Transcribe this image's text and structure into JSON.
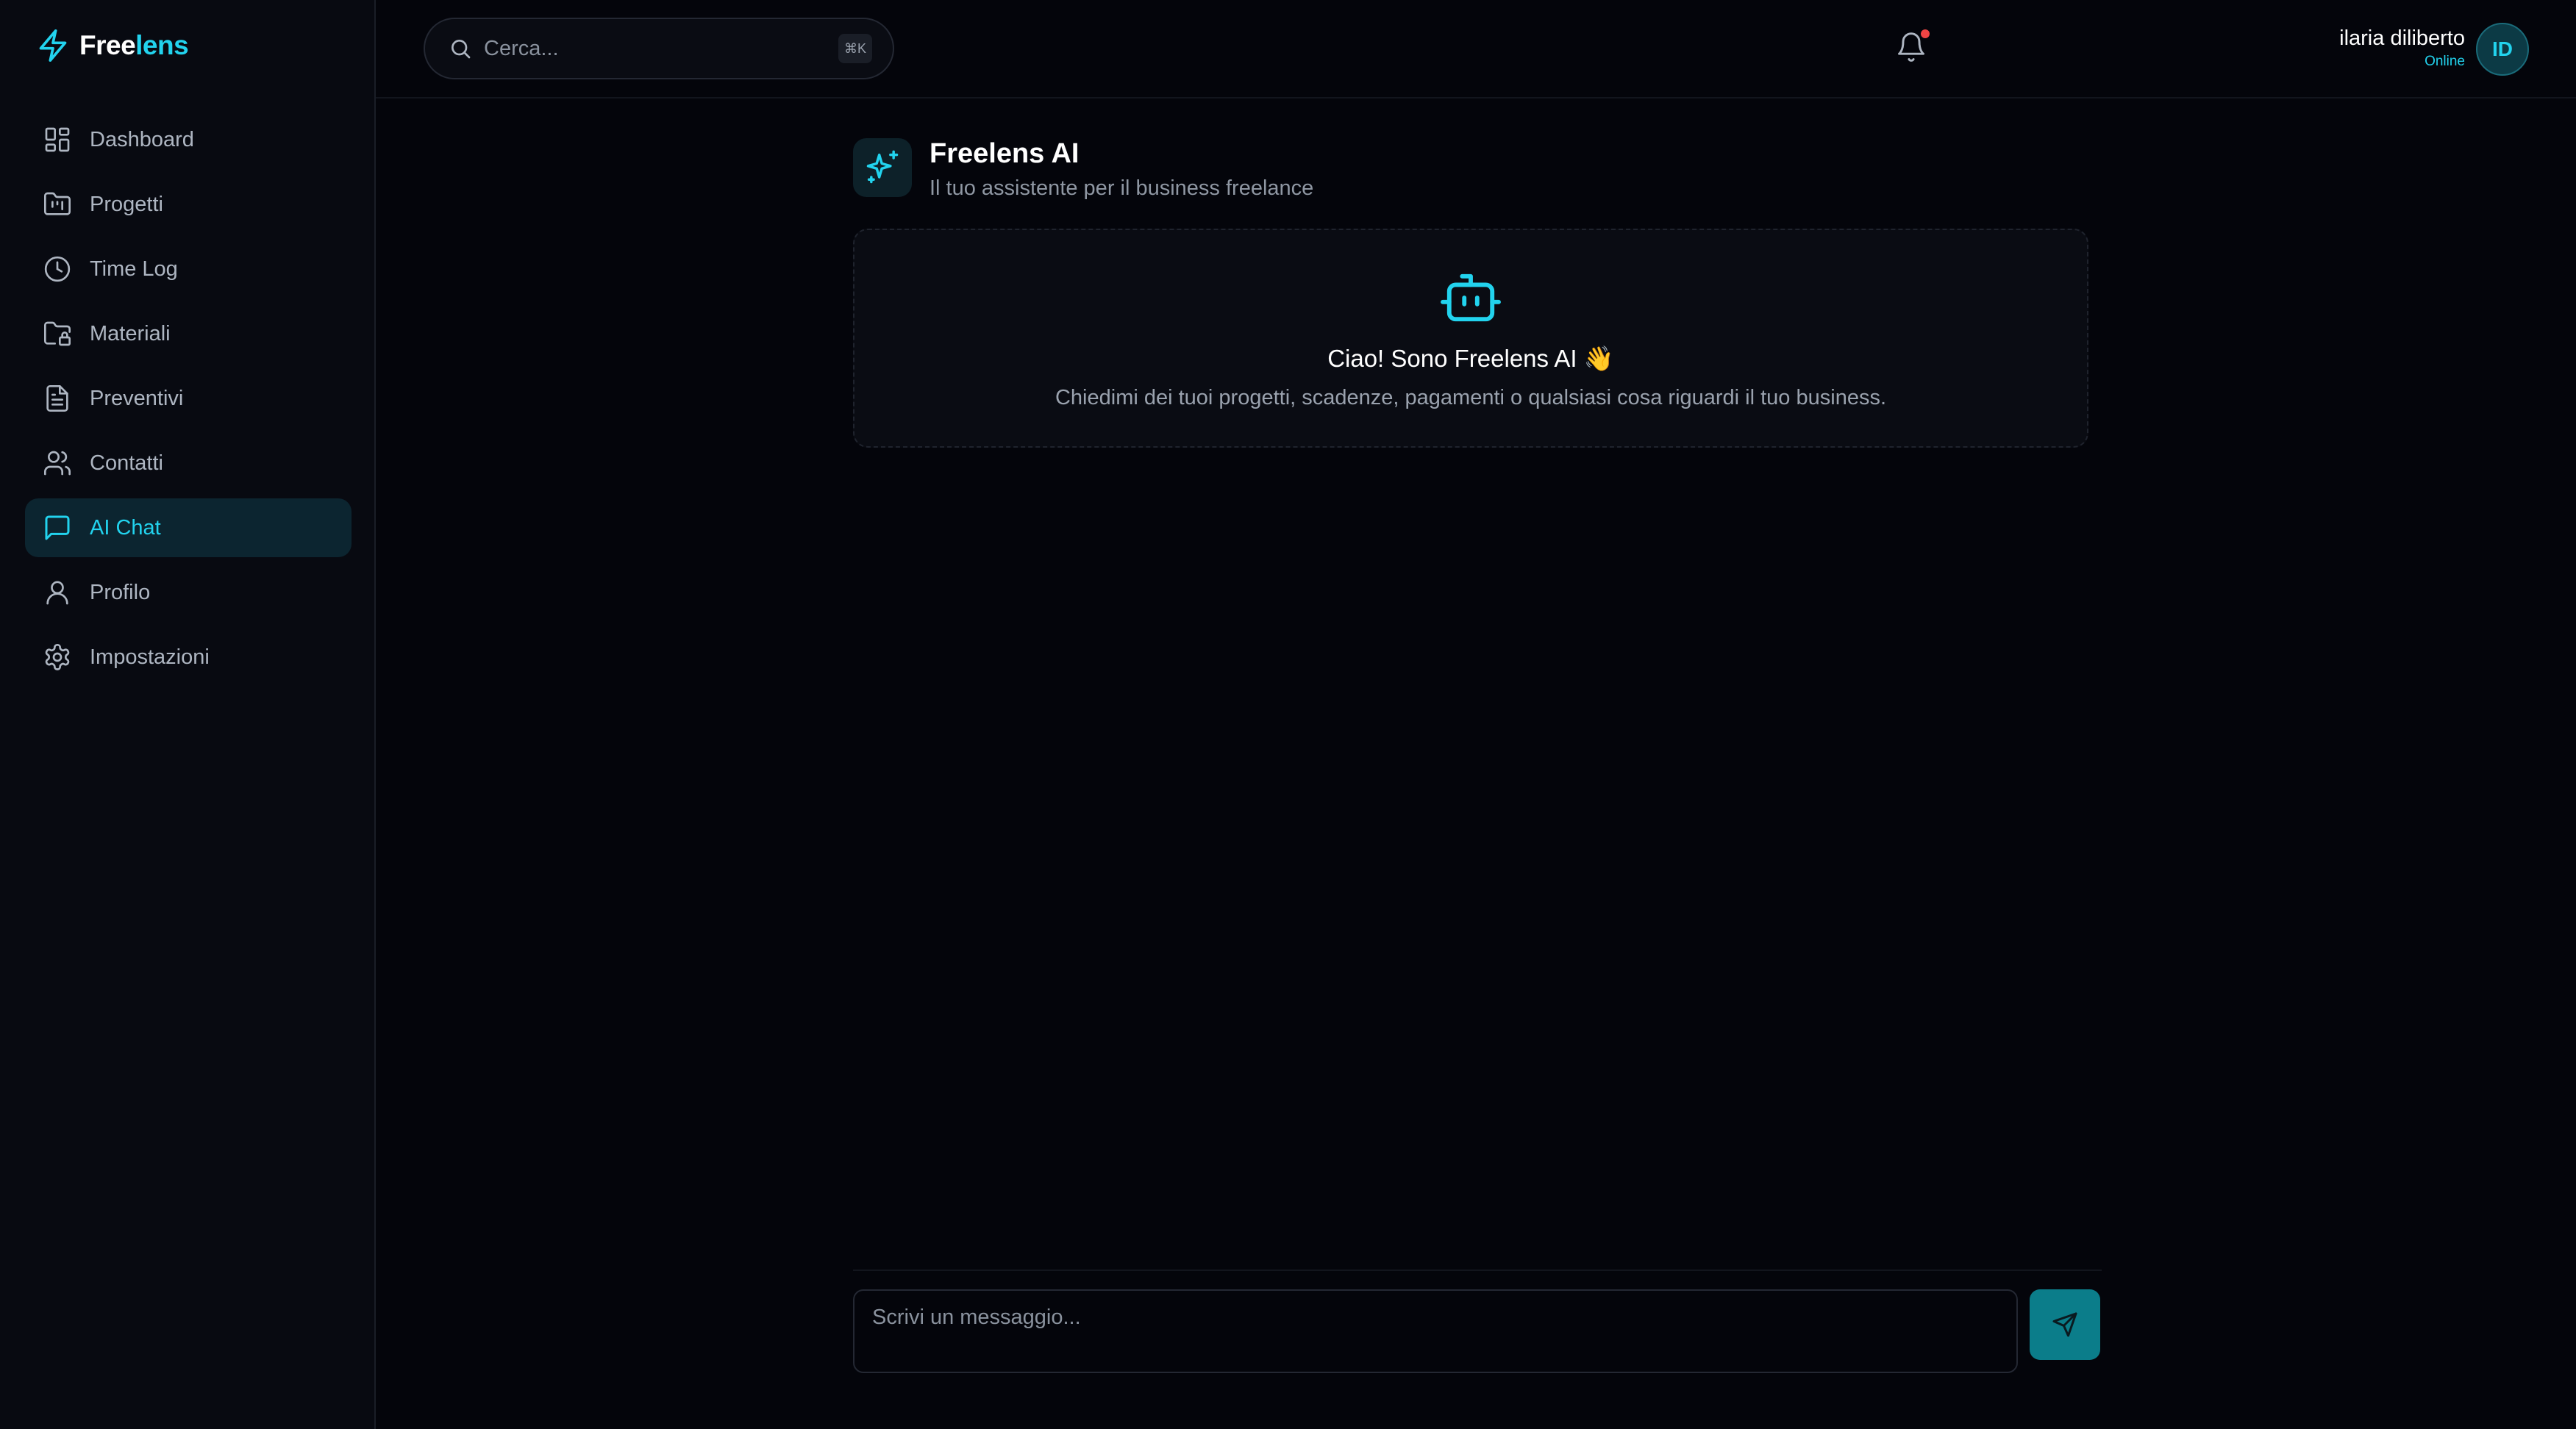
{
  "app": {
    "brand_part1": "Free",
    "brand_part2": "lens",
    "accent_color": "#22d3ee",
    "background_color": "#04050b"
  },
  "sidebar": {
    "items": [
      {
        "label": "Dashboard",
        "icon": "dashboard-grid-icon",
        "active": false
      },
      {
        "label": "Progetti",
        "icon": "folder-kanban-icon",
        "active": false
      },
      {
        "label": "Time Log",
        "icon": "clock-icon",
        "active": false
      },
      {
        "label": "Materiali",
        "icon": "folder-lock-icon",
        "active": false
      },
      {
        "label": "Preventivi",
        "icon": "file-text-icon",
        "active": false
      },
      {
        "label": "Contatti",
        "icon": "users-icon",
        "active": false
      },
      {
        "label": "AI Chat",
        "icon": "message-square-icon",
        "active": true
      },
      {
        "label": "Profilo",
        "icon": "user-icon",
        "active": false
      },
      {
        "label": "Impostazioni",
        "icon": "gear-icon",
        "active": false
      }
    ]
  },
  "topbar": {
    "search_placeholder": "Cerca...",
    "search_shortcut": "⌘K",
    "notification_icon": "bell-icon",
    "has_unread_notifications": true,
    "user": {
      "name": "ilaria diliberto",
      "status": "Online",
      "initials": "ID"
    }
  },
  "chat": {
    "title": "Freelens AI",
    "subtitle": "Il tuo assistente per il business freelance",
    "header_icon": "sparkles-icon",
    "welcome": {
      "icon": "bot-icon",
      "title": "Ciao! Sono Freelens AI 👋",
      "text": "Chiedimi dei tuoi progetti, scadenze, pagamenti o qualsiasi cosa riguardi il tuo business."
    },
    "composer": {
      "placeholder": "Scrivi un messaggio...",
      "value": "",
      "send_icon": "send-icon"
    }
  }
}
